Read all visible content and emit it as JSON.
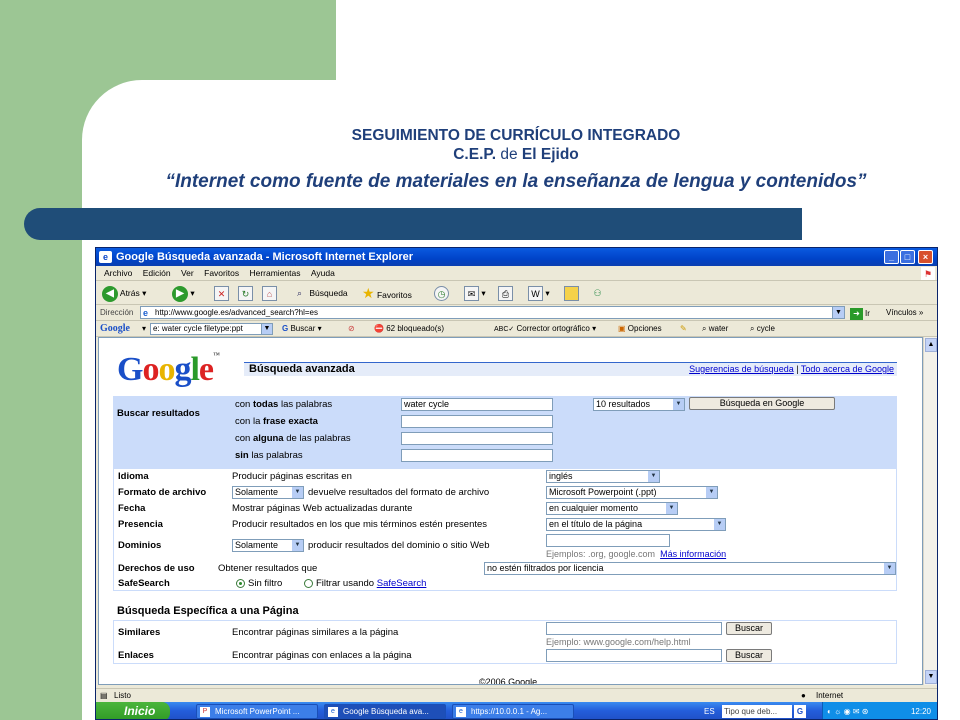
{
  "slide": {
    "title_line1": "SEGUIMIENTO DE CURRÍCULO INTEGRADO",
    "title_line2_a": "C.E.P.",
    "title_line2_b": "de",
    "title_line2_c": "El",
    "title_line2_d": "Ejido",
    "subtitle": "“Internet como fuente de materiales en la enseñanza de lengua y contenidos”",
    "colors": {
      "green": "#9cc694",
      "band": "#1f4d78",
      "title": "#1f3f7a"
    }
  },
  "window": {
    "title": "Google Búsqueda avanzada - Microsoft Internet Explorer",
    "menu": [
      "Archivo",
      "Edición",
      "Ver",
      "Favoritos",
      "Herramientas",
      "Ayuda"
    ],
    "toolbar": {
      "back": "Atrás",
      "search": "Búsqueda",
      "favorites": "Favoritos"
    },
    "address": {
      "label": "Dirección",
      "url": "http://www.google.es/advanced_search?hl=es",
      "go": "Ir",
      "links": "Vínculos"
    },
    "google_toolbar": {
      "logo": "Google",
      "query": "e: water cycle filetype:ppt",
      "search": "Buscar",
      "blocked": "62 bloqueado(s)",
      "spell": "Corrector ortográfico",
      "options": "Opciones",
      "term1": "water",
      "term2": "cycle"
    },
    "status": {
      "left": "Listo",
      "right": "Internet"
    }
  },
  "page": {
    "logo": "Google",
    "heading": "Búsqueda avanzada",
    "link_tips": "Sugerencias de búsqueda",
    "link_sep": "|",
    "link_about": "Todo acerca de Google",
    "find": {
      "label": "Buscar resultados",
      "all_pre": "con ",
      "all_bold": "todas",
      "all_post": " las palabras",
      "all_value": "water cycle",
      "phrase_pre": "con la ",
      "phrase_bold": "frase exacta",
      "any_pre": "con ",
      "any_bold": "alguna",
      "any_post": " de las palabras",
      "none_bold": "sin",
      "none_post": " las palabras",
      "results_select": "10 resultados",
      "search_button": "Búsqueda en Google"
    },
    "rows": {
      "idioma_label": "Idioma",
      "idioma_text": "Producir páginas escritas en",
      "idioma_value": "inglés",
      "formato_label": "Formato de archivo",
      "formato_mode": "Solamente",
      "formato_text": "devuelve resultados del formato de archivo",
      "formato_value": "Microsoft Powerpoint (.ppt)",
      "fecha_label": "Fecha",
      "fecha_text": "Mostrar páginas Web actualizadas durante",
      "fecha_value": "en cualquier momento",
      "presencia_label": "Presencia",
      "presencia_text": "Producir resultados en los que mis términos estén presentes",
      "presencia_value": "en el título de la página",
      "dominios_label": "Dominios",
      "dominios_mode": "Solamente",
      "dominios_text": "producir resultados del dominio o sitio Web",
      "dominios_example": "Ejemplos: .org, google.com",
      "dominios_more": "Más información",
      "derechos_label": "Derechos de uso",
      "derechos_text": "Obtener resultados que",
      "derechos_value": "no estén filtrados por licencia",
      "safe_label": "SafeSearch",
      "safe_off": "Sin filtro",
      "safe_on_pre": "Filtrar usando",
      "safe_on_link": "SafeSearch"
    },
    "specific": {
      "title": "Búsqueda Específica a una Página",
      "similar_label": "Similares",
      "similar_text": "Encontrar páginas similares a la página",
      "similar_example": "Ejemplo: www.google.com/help.html",
      "links_label": "Enlaces",
      "links_text": "Encontrar páginas con enlaces a la página",
      "button": "Buscar"
    },
    "copyright": "©2006 Google"
  },
  "taskbar": {
    "start": "Inicio",
    "tasks": [
      "Microsoft PowerPoint ...",
      "Google Búsqueda ava...",
      "https://10.0.0.1 - Ag..."
    ],
    "lang": "ES",
    "search_hint": "Tipo que deb...",
    "clock": "12:20"
  }
}
